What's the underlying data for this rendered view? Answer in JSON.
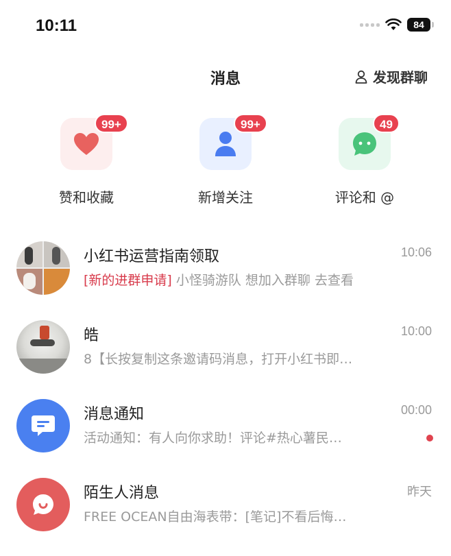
{
  "status_bar": {
    "time": "10:11",
    "battery": "84"
  },
  "header": {
    "title": "消息",
    "discover_label": "发现群聊"
  },
  "categories": [
    {
      "label": "赞和收藏",
      "badge": "99+",
      "icon": "heart-icon",
      "color": "#e8625f",
      "bg": "#fdeeee"
    },
    {
      "label": "新增关注",
      "badge": "99+",
      "icon": "person-icon",
      "color": "#4a7cf0",
      "bg": "#e9f0ff"
    },
    {
      "label": "评论和 @",
      "badge": "49",
      "icon": "chat-bubble-icon",
      "color": "#49c37a",
      "bg": "#e7f8ee"
    }
  ],
  "conversations": [
    {
      "title": "小红书运营指南领取",
      "time": "10:06",
      "tag": "[新的进群申请]",
      "preview": " 小怪骑游队 想加入群聊 去查看"
    },
    {
      "title": "皓",
      "time": "10:00",
      "preview": "8【长按复制这条邀请码消息，打开小红书即…"
    },
    {
      "title": "消息通知",
      "time": "00:00",
      "preview": "活动通知：有人向你求助！评论#热心薯民…",
      "unread": true
    },
    {
      "title": "陌生人消息",
      "time": "昨天",
      "preview": "FREE OCEAN自由海表带：[笔记]不看后悔…"
    }
  ],
  "colors": {
    "badge_red": "#e8414f",
    "notify_blue": "#4a80f0",
    "stranger_red": "#e35d5d"
  }
}
